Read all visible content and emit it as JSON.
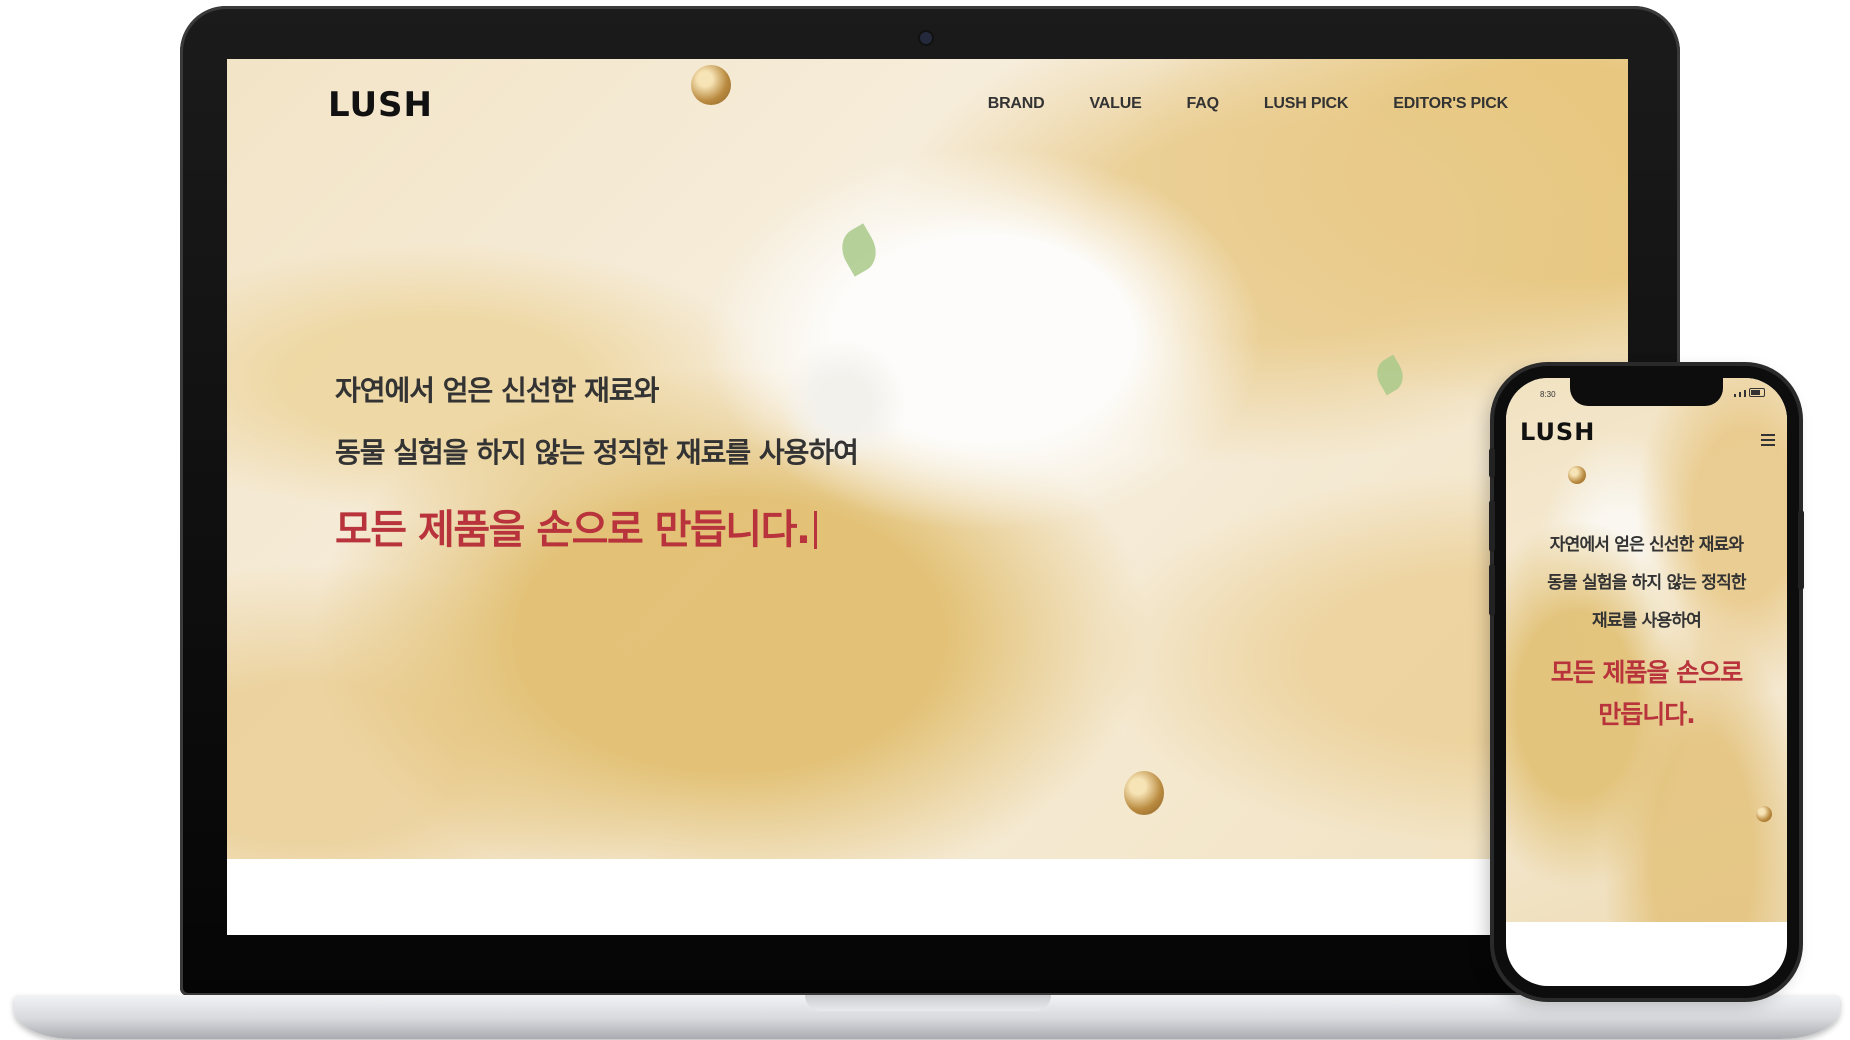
{
  "brand": "LUSH",
  "nav": {
    "links": [
      "BRAND",
      "VALUE",
      "FAQ",
      "LUSH PICK",
      "EDITOR'S PICK"
    ]
  },
  "hero": {
    "line1": "자연에서 얻은 신선한 재료와",
    "line2": "동물 실험을 하지 않는 정직한 재료를 사용하여",
    "emphasis": "모든 제품을 손으로 만듭니다."
  },
  "mobile": {
    "status_time": "8:30",
    "line1": "자연에서 얻은 신선한 재료와",
    "line2": "동물 실험을 하지 않는 정직한",
    "line3": "재료를 사용하여",
    "emphasis_line1": "모든 제품을 손으로",
    "emphasis_line2": "만듭니다."
  },
  "colors": {
    "accent": "#b8333b",
    "text": "#333333",
    "device_frame": "#0d0d0d"
  },
  "icons": {
    "menu": "hamburger-icon",
    "camera": "webcam-icon"
  }
}
